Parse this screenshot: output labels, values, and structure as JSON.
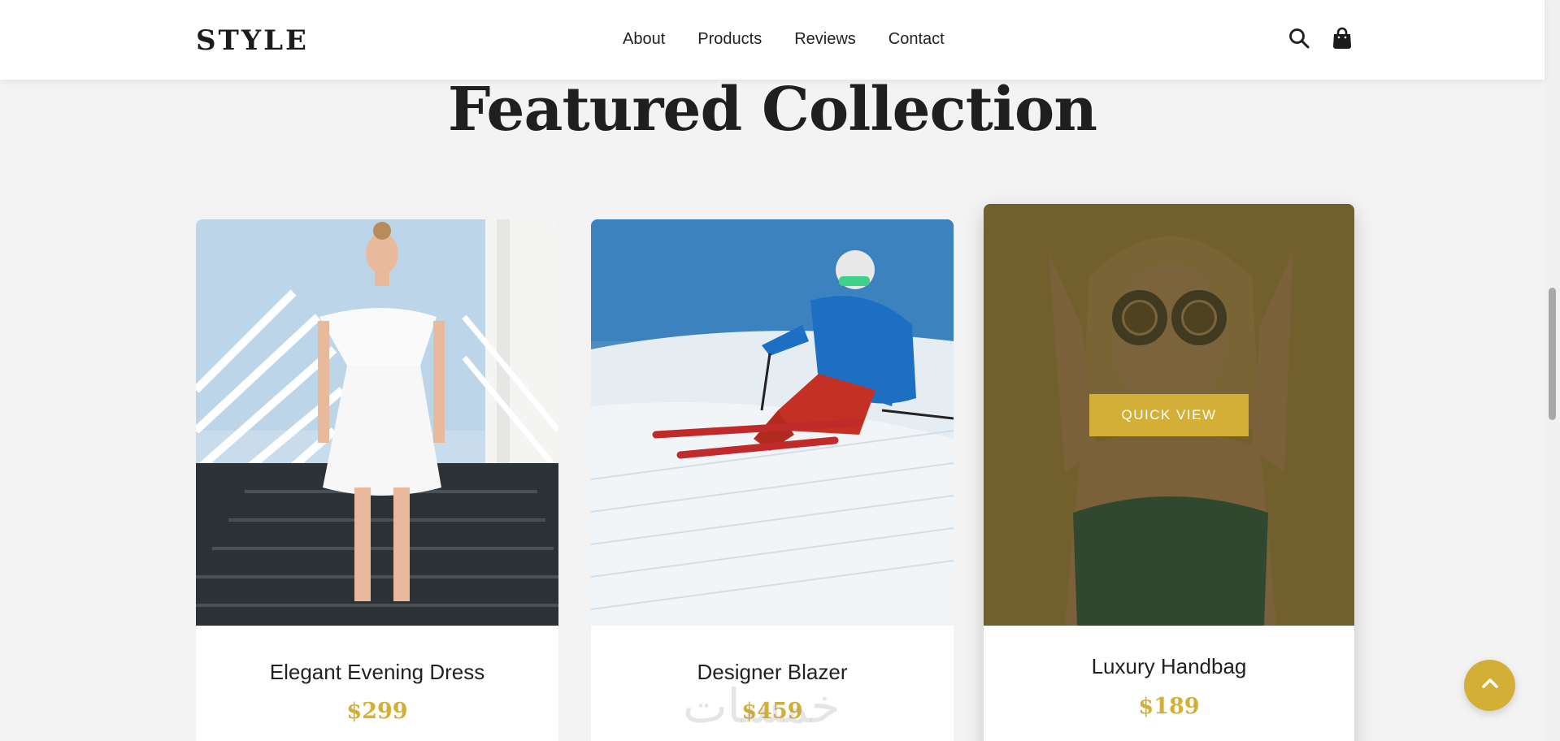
{
  "nav": {
    "brand": "STYLE",
    "links": [
      "About",
      "Products",
      "Reviews",
      "Contact"
    ],
    "icons": [
      "search-icon",
      "shopping-bag-icon"
    ]
  },
  "section": {
    "title": "Featured Collection"
  },
  "products": [
    {
      "name": "Elegant Evening Dress",
      "price": "$299",
      "image": "woman in white dress on stairs"
    },
    {
      "name": "Designer Blazer",
      "price": "$459",
      "image": "skier on snowy slope"
    },
    {
      "name": "Luxury Handbag",
      "price": "$189",
      "image": "woman with round sunglasses",
      "quick_view_label": "QUICK VIEW"
    }
  ],
  "watermark": "خمسات",
  "colors": {
    "accent": "#d4af37",
    "background": "#f3f3f3",
    "text": "#222222"
  },
  "scroll_top_icon": "chevron-up-icon"
}
